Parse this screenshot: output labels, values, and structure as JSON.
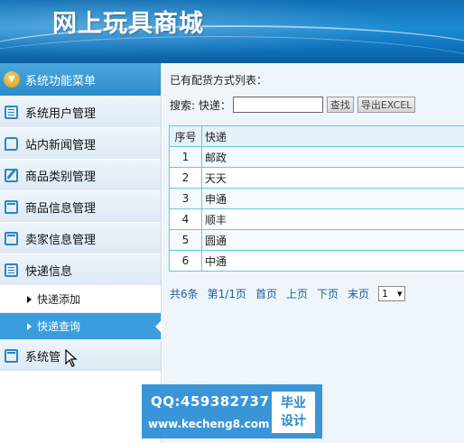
{
  "header": {
    "title": "网上玩具商城"
  },
  "sidebar": {
    "menu_title": "系统功能菜单",
    "items": [
      {
        "label": "系统用户管理",
        "icon": "list-icon"
      },
      {
        "label": "站内新闻管理",
        "icon": "chat-icon"
      },
      {
        "label": "商品类别管理",
        "icon": "edit-icon"
      },
      {
        "label": "商品信息管理",
        "icon": "calendar-icon"
      },
      {
        "label": "卖家信息管理",
        "icon": "calendar-icon"
      },
      {
        "label": "快递信息",
        "icon": "list-icon"
      }
    ],
    "sub_items": [
      {
        "label": "快递添加"
      },
      {
        "label": "快递查询"
      }
    ],
    "last_item": {
      "label": "系统管",
      "icon": "calendar-icon"
    }
  },
  "main": {
    "list_title": "已有配货方式列表：",
    "search_label": "搜索: 快递：",
    "search_value": "",
    "search_button": "查找",
    "export_button": "导出EXCEL",
    "table": {
      "headers": [
        "序号",
        "快递"
      ],
      "rows": [
        [
          "1",
          "邮政"
        ],
        [
          "2",
          "天天"
        ],
        [
          "3",
          "申通"
        ],
        [
          "4",
          "顺丰"
        ],
        [
          "5",
          "圆通"
        ],
        [
          "6",
          "中通"
        ]
      ]
    },
    "pager": {
      "total": "共6条",
      "page": "第1/1页",
      "first": "首页",
      "prev": "上页",
      "next": "下页",
      "last": "末页",
      "select_value": "1"
    }
  },
  "watermark": {
    "qq": "QQ:459382737",
    "url": "www.kecheng8.com",
    "badge_line1": "毕业",
    "badge_line2": "设计"
  }
}
